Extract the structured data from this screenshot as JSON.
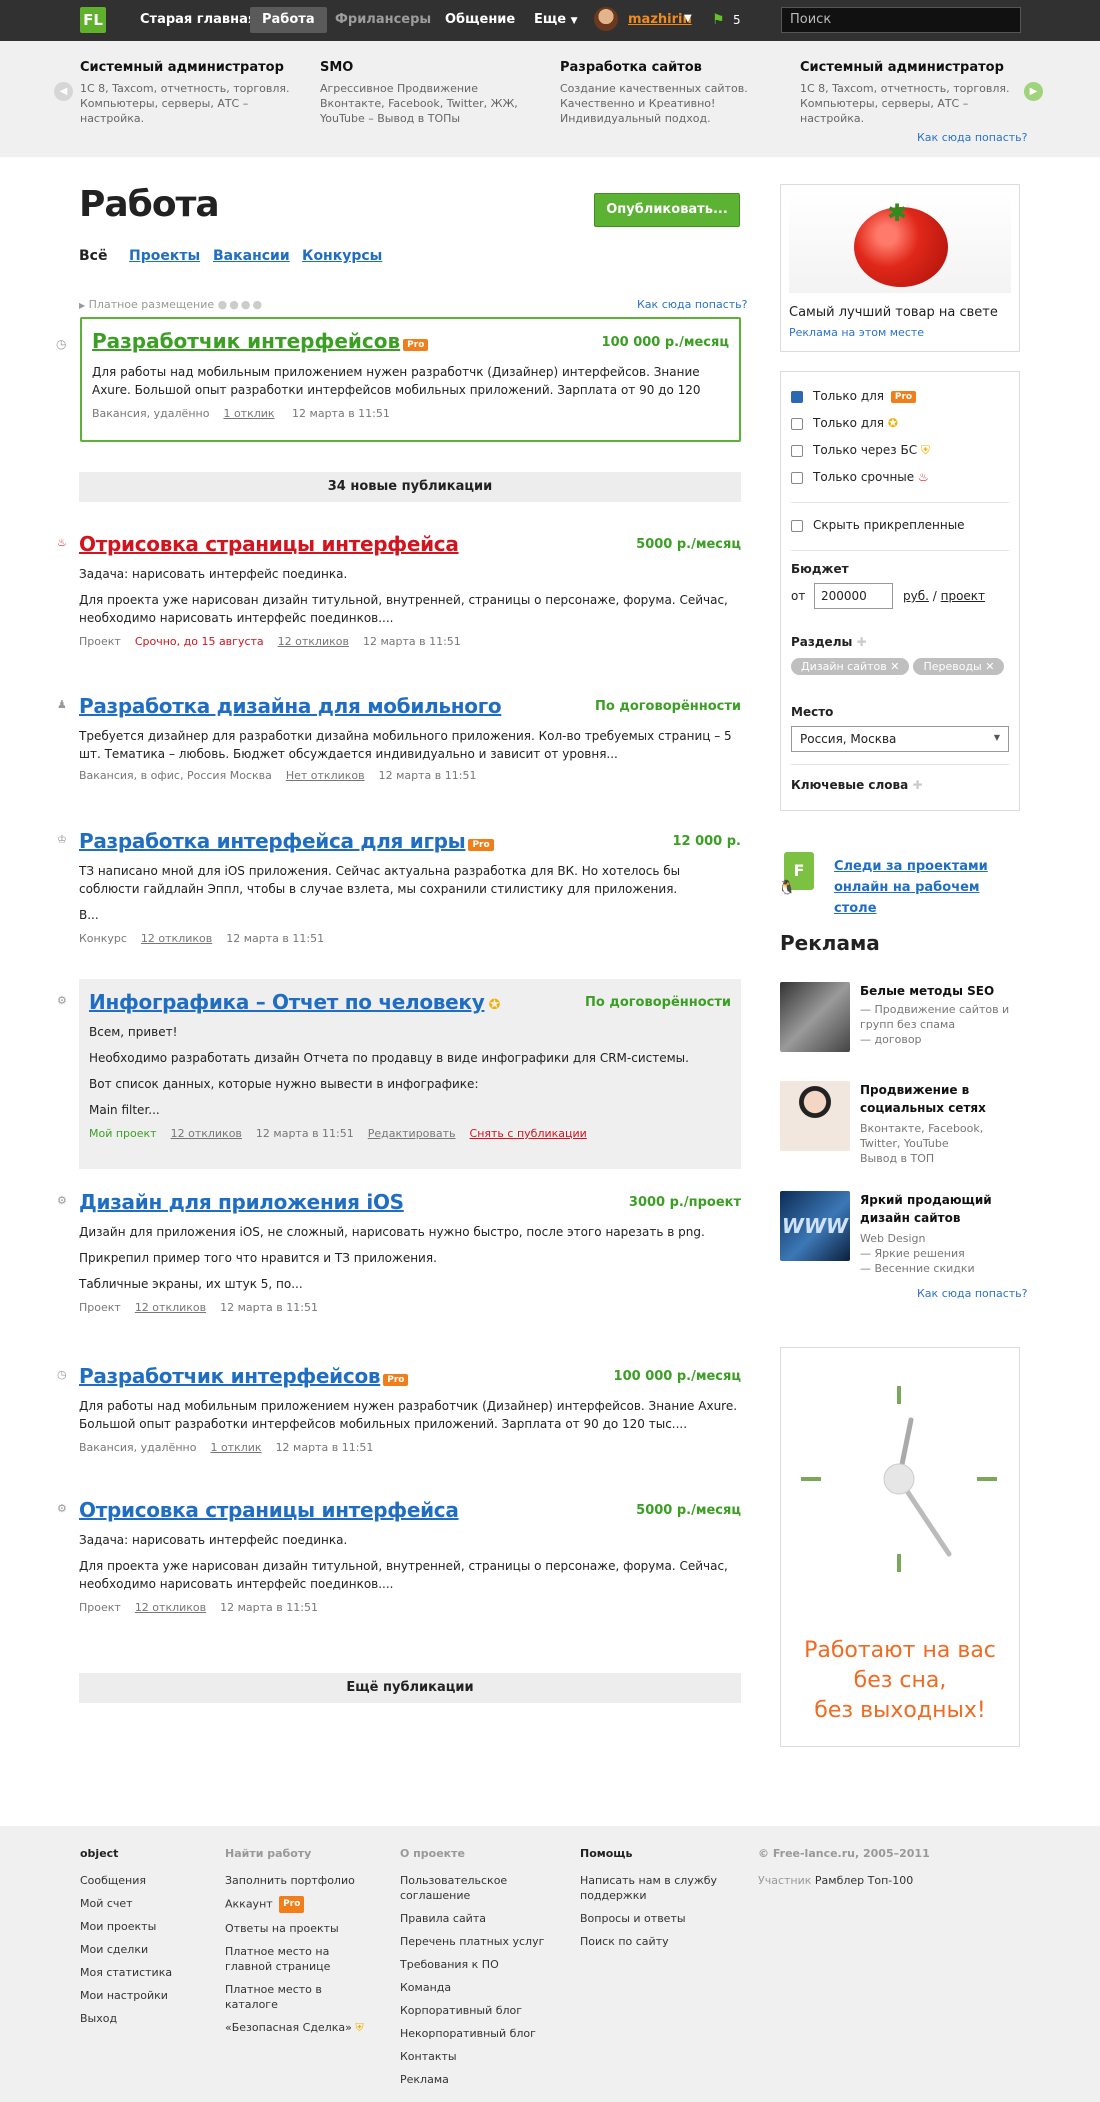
{
  "header": {
    "logo": "FL",
    "nav": [
      "Старая главная",
      "Работа",
      "Фрилансеры",
      "Общение",
      "Еще"
    ],
    "active_nav": "Работа",
    "user": "mazhirin",
    "notify_count": "5",
    "search_placeholder": "Поиск"
  },
  "promo": {
    "cards": [
      {
        "title": "Системный администратор",
        "desc": "1С 8, Taxcom, отчетность, торговля. Компьютеры, серверы, АТС – настройка."
      },
      {
        "title": "SMO",
        "desc": "Агрессивное Продвижение Вконтакте, Facebook, Twitter, ЖЖ, YouTube – Вывод в ТОПы"
      },
      {
        "title": "Разработка сайтов",
        "desc": "Создание качественных сайтов. Качественно и Креативно! Индивидуальный подход."
      },
      {
        "title": "Системный администратор",
        "desc": "1С 8, Taxcom, отчетность, торговля. Компьютеры, серверы, АТС – настройка."
      }
    ],
    "how_link": "Как сюда попасть?"
  },
  "main": {
    "title": "Работа",
    "publish_button": "Опубликовать...",
    "tabs": [
      "Всё",
      "Проекты",
      "Вакансии",
      "Конкурсы"
    ],
    "paid_label": "Платное размещение",
    "paid_how": "Как сюда попасть?",
    "new_pubs": "34 новые публикации",
    "more_pubs": "Ещё публикации"
  },
  "featured": {
    "title": "Разработчик интерфейсов",
    "pro": "Pro",
    "price": "100 000 р./месяц",
    "desc": "Для работы над мобильным приложением нужен разработчк (Дизайнер) интерфейсов. Знание Axure. Большой опыт разработки интерфейсов мобильных приложений. Зарплата от 90 до 120",
    "meta": [
      "Вакансия, удалённо",
      "1 отклик",
      "12 марта в 11:51"
    ]
  },
  "jobs": [
    {
      "title": "Отрисовка страницы интерфейса",
      "price": "5000 р./месяц",
      "paras": [
        "Задача: нарисовать интерфейс поединка.",
        "Для проекта уже нарисован дизайн титульной, внутренней, страницы о персонаже, форума. Сейчас, необходимо нарисовать интерфейс поединков...."
      ],
      "meta_type": "Проект",
      "urgent": "Срочно, до 15 августа",
      "responses": "12 откликов",
      "date": "12 марта в 11:51"
    },
    {
      "title": "Разработка дизайна для мобильного",
      "price": "По договорённости",
      "paras": [
        "Требуется дизайнер для разработки дизайна мобильного приложения. Кол-во требуемых страниц – 5 шт. Тематика – любовь. Бюджет обсуждается индивидуально и зависит от уровня..."
      ],
      "meta_type": "Вакансия, в офис, Россия Москва",
      "responses": "Нет откликов",
      "date": "12 марта в 11:51"
    },
    {
      "title": "Разработка интерфейса для игры",
      "pro": "Pro",
      "price": "12 000 р.",
      "paras": [
        "ТЗ написано мной для iOS приложения. Сейчас актуальна разработка для ВК. Но хотелось бы соблюсти гайдлайн Эппл, чтобы в случае взлета, мы сохранили стилистику для приложения.",
        "В..."
      ],
      "meta_type": "Конкурс",
      "responses": "12 откликов",
      "date": "12 марта в 11:51"
    },
    {
      "title": "Инфографика – Отчет по человеку",
      "price": "По договорённости",
      "paras": [
        "Всем, привет!",
        "Необходимо разработать дизайн Отчета по продавцу в виде инфографики для CRM-системы.",
        "Вот список данных, которые нужно вывести в инфографике:",
        "Main filter..."
      ],
      "meta_type": "Мой проект",
      "responses": "12 откликов",
      "date": "12 марта в 11:51",
      "edit": "Редактировать",
      "remove": "Снять с публикации"
    },
    {
      "title": "Дизайн для приложения iOS",
      "price": "3000 р./проект",
      "paras": [
        "Дизайн для приложения iOS, не сложный, нарисовать нужно быстро, после этого нарезать в png.",
        "Прикрепил пример того что нравится и ТЗ приложения.",
        "Табличные экраны, их штук 5, по..."
      ],
      "meta_type": "Проект",
      "responses": "12 откликов",
      "date": "12 марта в 11:51"
    },
    {
      "title": "Разработчик интерфейсов",
      "pro": "Pro",
      "price": "100 000 р./месяц",
      "paras": [
        "Для работы над мобильным приложением нужен разработчик (Дизайнер) интерфейсов. Знание Axure. Большой опыт разработки интерфейсов мобильных приложений. Зарплата от 90 до 120 тыс...."
      ],
      "meta_type": "Вакансия, удалённо",
      "responses": "1 отклик",
      "date": "12 марта в 11:51"
    },
    {
      "title": "Отрисовка страницы интерфейса",
      "price": "5000 р./месяц",
      "paras": [
        "Задача: нарисовать интерфейс поединка.",
        "Для проекта уже нарисован дизайн титульной, внутренней, страницы о персонаже, форума. Сейчас, необходимо нарисовать интерфейс поединков...."
      ],
      "meta_type": "Проект",
      "responses": "12 откликов",
      "date": "12 марта в 11:51"
    }
  ],
  "sidebar": {
    "product_caption": "Самый лучший товар на свете",
    "product_link": "Реклама на этом месте",
    "filters": [
      {
        "label": "Только для",
        "checked": true,
        "badge": "Pro"
      },
      {
        "label": "Только для",
        "checked": false
      },
      {
        "label": "Только через БС",
        "checked": false
      },
      {
        "label": "Только срочные",
        "checked": false
      }
    ],
    "hide_pinned": "Скрыть прикрепленные",
    "budget_label": "Бюджет",
    "budget_from": "от",
    "budget_value": "200000",
    "budget_currency": "руб.",
    "budget_unit": "проект",
    "sections_label": "Разделы",
    "sections": [
      "Дизайн сайтов",
      "Переводы"
    ],
    "place_label": "Место",
    "place_value": "Россия, Москва",
    "keywords_label": "Ключевые слова",
    "desktop_link": "Следи за проектами онлайн на рабочем столе",
    "ads_title": "Реклама",
    "ads": [
      {
        "title": "Белые методы SEO",
        "desc": [
          "— Продвижение сайтов и групп без спама",
          "— договор"
        ]
      },
      {
        "title": "Продвижение в социальных сетях",
        "desc": [
          "Вконтакте, Facebook, Twitter, YouTube",
          "Вывод в ТОП"
        ]
      },
      {
        "title": "Яркий продающий дизайн сайтов",
        "desc": [
          "Web Design",
          "— Яркие решения",
          "— Весенние скидки"
        ]
      }
    ],
    "ads_how": "Как сюда попасть?",
    "clock_text": [
      "Работают на вас",
      "без сна,",
      "без выходных!"
    ]
  },
  "footer": {
    "col1_title": "object",
    "col1": [
      "Сообщения",
      "Мой счет",
      "Мои проекты",
      "Мои сделки",
      "Моя статистика",
      "Мои настройки",
      "Выход"
    ],
    "col2_title": "Найти работу",
    "col2": [
      "Заполнить портфолио",
      "Аккаунт",
      "Ответы на проекты",
      "Платное место на главной странице",
      "Платное место в каталоге",
      "«Безопасная Сделка»"
    ],
    "col3_title": "О проекте",
    "col3": [
      "Пользовательское соглашение",
      "Правила сайта",
      "Перечень платных услуг",
      "Требования к ПО",
      "Команда",
      "Корпоративный блог",
      "Некорпоративный блог",
      "Контакты",
      "Реклама"
    ],
    "col4_title": "Помощь",
    "col4": [
      "Написать нам в службу поддержки",
      "Вопросы и ответы",
      "Поиск по сайту"
    ],
    "copyright": "© Free-lance.ru, 2005–2011",
    "member_prefix": "Участник",
    "member": "Рамблер Топ-100"
  },
  "colors": {
    "accent_green": "#5bb233",
    "link_blue": "#1f6ec3",
    "urgent_red": "#d2141f",
    "pro_orange": "#f07e1b"
  }
}
